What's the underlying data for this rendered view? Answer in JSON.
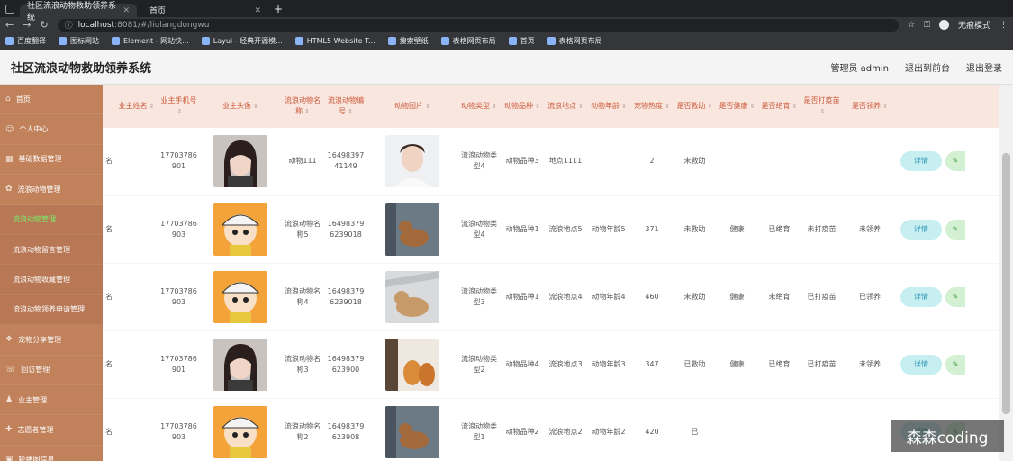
{
  "browser": {
    "tabs": [
      {
        "label": "社区流浪动物救助领养系统"
      },
      {
        "label": "首页"
      }
    ],
    "url_host": "localhost",
    "url_port": ":8081/#/liulangdongwu",
    "incognito": "无痕模式"
  },
  "bookmarks": [
    "百度翻译",
    "图标网站",
    "Element - 网站快...",
    "Layui - 经典开源模...",
    "HTML5 Website T...",
    "搜索壁纸",
    "表格网页布局",
    "首页",
    "表格网页布局"
  ],
  "app": {
    "title": "社区流浪动物救助领养系统",
    "admin": "管理员 admin",
    "to_front": "退出到前台",
    "logout": "退出登录"
  },
  "sidebar": [
    {
      "label": "首页",
      "icon": "home-icon",
      "sub": false,
      "active": false
    },
    {
      "label": "个人中心",
      "icon": "user-icon",
      "sub": false,
      "active": false
    },
    {
      "label": "基础数据管理",
      "icon": "grid-icon",
      "sub": false,
      "active": false
    },
    {
      "label": "流浪动物管理",
      "icon": "paw-icon",
      "sub": false,
      "active": false
    },
    {
      "label": "流浪动物管理",
      "icon": "",
      "sub": true,
      "active": true
    },
    {
      "label": "流浪动物留言管理",
      "icon": "",
      "sub": true,
      "active": false
    },
    {
      "label": "流浪动物收藏管理",
      "icon": "",
      "sub": true,
      "active": false
    },
    {
      "label": "流浪动物领养申请管理",
      "icon": "",
      "sub": true,
      "active": false
    },
    {
      "label": "宠物分享管理",
      "icon": "share-icon",
      "sub": false,
      "active": false
    },
    {
      "label": "回访管理",
      "icon": "visit-icon",
      "sub": false,
      "active": false
    },
    {
      "label": "业主管理",
      "icon": "owner-icon",
      "sub": false,
      "active": false
    },
    {
      "label": "志愿者管理",
      "icon": "volunteer-icon",
      "sub": false,
      "active": false
    },
    {
      "label": "轮播图信息",
      "icon": "carousel-icon",
      "sub": false,
      "active": false
    }
  ],
  "table": {
    "headers": [
      "",
      "业主姓名",
      "业主手机号",
      "业主头像",
      "流浪动物名称",
      "流浪动物编号",
      "动物图片",
      "动物类型",
      "动物品种",
      "流浪地点",
      "动物年龄",
      "宠物热度",
      "是否救助",
      "是否健康",
      "是否绝育",
      "是否打疫苗",
      "是否领养",
      ""
    ],
    "sort_glyph": "⇕",
    "detail_label": "详情",
    "edit_glyph": "✎",
    "rows": [
      {
        "c0": "名",
        "name": "",
        "phone": "17703786901",
        "avatar": "avatar-woman",
        "aname": "动物111",
        "ano": "1649839741149",
        "img": "img-man",
        "atype": "流浪动物类型4",
        "breed": "动物品种3",
        "place": "地点1111",
        "age": "",
        "heat": "2",
        "rescue": "未救助",
        "health": "",
        "neuter": "",
        "vaccine": "",
        "adopt": ""
      },
      {
        "c0": "名",
        "name": "",
        "phone": "17703786903",
        "avatar": "avatar-cartoon",
        "aname": "流浪动物名称5",
        "ano": "16498379623901​8",
        "img": "img-dog",
        "atype": "流浪动物类型4",
        "breed": "动物品种1",
        "place": "流浪地点5",
        "age": "动物年龄5",
        "heat": "371",
        "rescue": "未救助",
        "health": "健康",
        "neuter": "已绝育",
        "vaccine": "未打疫苗",
        "adopt": "未领养"
      },
      {
        "c0": "名",
        "name": "",
        "phone": "17703786903",
        "avatar": "avatar-cartoon",
        "aname": "流浪动物名称4",
        "ano": "16498379623901​8",
        "img": "img-dog2",
        "atype": "流浪动物类型3",
        "breed": "动物品种1",
        "place": "流浪地点4",
        "age": "动物年龄4",
        "heat": "460",
        "rescue": "未救助",
        "health": "健康",
        "neuter": "未绝育",
        "vaccine": "已打疫苗",
        "adopt": "已领养"
      },
      {
        "c0": "名",
        "name": "",
        "phone": "17703786901",
        "avatar": "avatar-woman",
        "aname": "流浪动物名称3",
        "ano": "16498379623900",
        "img": "img-cats",
        "atype": "流浪动物类型2",
        "breed": "动物品种4",
        "place": "流浪地点3",
        "age": "动物年龄3",
        "heat": "347",
        "rescue": "已救助",
        "health": "健康",
        "neuter": "已绝育",
        "vaccine": "已打疫苗",
        "adopt": "未领养"
      },
      {
        "c0": "名",
        "name": "",
        "phone": "17703786903",
        "avatar": "avatar-cartoon",
        "aname": "流浪动物名称2",
        "ano": "16498379623908",
        "img": "img-dog",
        "atype": "流浪动物类型1",
        "breed": "动物品种2",
        "place": "流浪地点2",
        "age": "动物年龄2",
        "heat": "420",
        "rescue": "已",
        "health": "",
        "neuter": "",
        "vaccine": "",
        "adopt": ""
      }
    ]
  },
  "watermark": "森森coding"
}
